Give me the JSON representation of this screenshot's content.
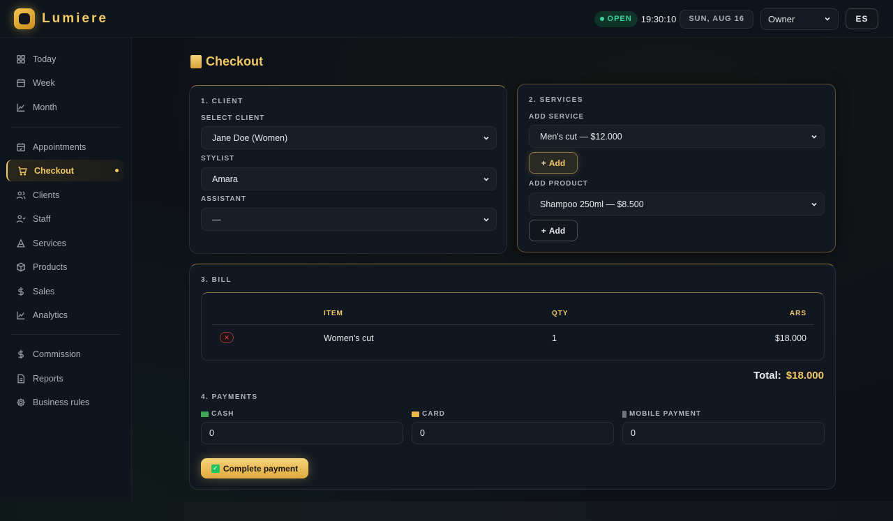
{
  "brand": {
    "name": "Lumiere"
  },
  "topbar": {
    "status": "OPEN",
    "time": "19:30:10",
    "date": "SUN, AUG 16",
    "role": "Owner",
    "language": "ES"
  },
  "sidebar": {
    "items": [
      {
        "label": "Today",
        "icon": "grid-icon"
      },
      {
        "label": "Week",
        "icon": "calendar-icon"
      },
      {
        "label": "Month",
        "icon": "chart-line-icon"
      },
      {
        "label": "Appointments",
        "icon": "calendar-check-icon"
      },
      {
        "label": "Checkout",
        "icon": "cart-icon",
        "active": true
      },
      {
        "label": "Clients",
        "icon": "users-icon"
      },
      {
        "label": "Staff",
        "icon": "staff-icon"
      },
      {
        "label": "Services",
        "icon": "scissors-icon"
      },
      {
        "label": "Products",
        "icon": "box-icon"
      },
      {
        "label": "Sales",
        "icon": "dollar-icon"
      },
      {
        "label": "Analytics",
        "icon": "analytics-icon"
      },
      {
        "label": "Commission",
        "icon": "dollar-icon"
      },
      {
        "label": "Reports",
        "icon": "document-icon"
      },
      {
        "label": "Business rules",
        "icon": "gear-icon"
      }
    ]
  },
  "page": {
    "title": "Checkout"
  },
  "client_section": {
    "heading": "1. CLIENT",
    "client_label": "SELECT CLIENT",
    "client_value": "Jane Doe (Women)",
    "stylist_label": "STYLIST",
    "stylist_value": "Amara",
    "assistant_label": "ASSISTANT",
    "assistant_value": "—"
  },
  "services_section": {
    "heading": "2. SERVICES",
    "service_label": "ADD SERVICE",
    "service_value": "Men's cut — $12.000",
    "add_label": "Add",
    "product_label": "ADD PRODUCT",
    "product_value": "Shampoo 250ml — $8.500"
  },
  "bill": {
    "heading": "3. BILL",
    "columns": {
      "item": "ITEM",
      "qty": "QTY",
      "amount": "ARS"
    },
    "rows": [
      {
        "item": "Women's cut",
        "qty": "1",
        "amount": "$18.000"
      }
    ],
    "remove_symbol": "✕",
    "total_label": "Total:",
    "total_value": "$18.000"
  },
  "payments": {
    "heading": "4. PAYMENTS",
    "cash_label": "CASH",
    "cash_value": "0",
    "card_label": "CARD",
    "card_value": "0",
    "mobile_label": "MOBILE PAYMENT",
    "mobile_value": "0",
    "complete_label": "Complete payment"
  },
  "colors": {
    "accent": "#f0c866",
    "background": "#0d1117",
    "status_green": "#34d399",
    "danger": "#ef4444"
  }
}
